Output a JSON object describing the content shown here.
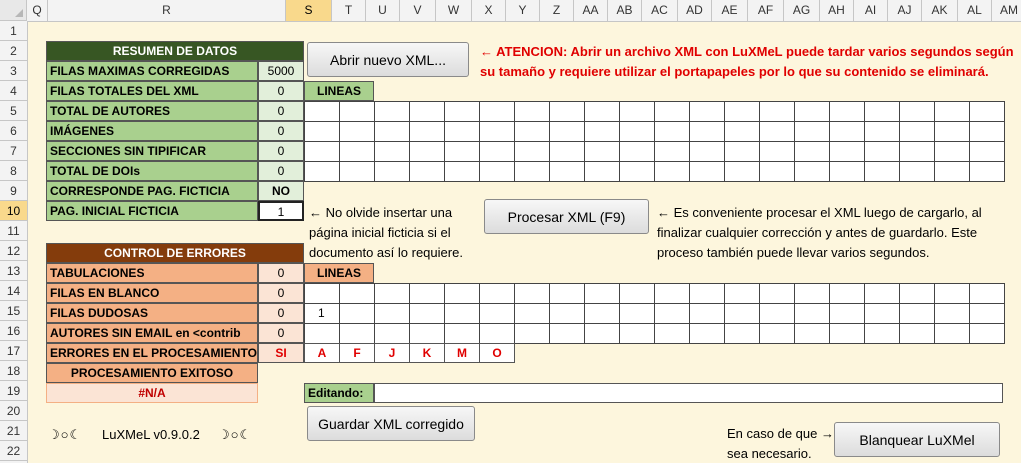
{
  "columns": [
    "Q",
    "R",
    "S",
    "T",
    "U",
    "V",
    "W",
    "X",
    "Y",
    "Z",
    "AA",
    "AB",
    "AC",
    "AD",
    "AE",
    "AF",
    "AG",
    "AH",
    "AI",
    "AJ",
    "AK",
    "AL",
    "AM"
  ],
  "selected_column": "S",
  "rows": [
    "1",
    "2",
    "3",
    "4",
    "5",
    "6",
    "7",
    "8",
    "9",
    "10",
    "11",
    "12",
    "13",
    "14",
    "15",
    "16",
    "17",
    "18",
    "19",
    "20",
    "21",
    "22"
  ],
  "selected_row": "10",
  "resumen": {
    "title": "RESUMEN DE DATOS",
    "items": [
      {
        "label": "FILAS MAXIMAS CORREGIDAS",
        "value": "5000"
      },
      {
        "label": "FILAS TOTALES DEL XML",
        "value": "0"
      },
      {
        "label": "TOTAL DE AUTORES",
        "value": "0"
      },
      {
        "label": "IMÁGENES",
        "value": "0"
      },
      {
        "label": "SECCIONES SIN TIPIFICAR",
        "value": "0"
      },
      {
        "label": "TOTAL DE DOIs",
        "value": "0"
      },
      {
        "label": "CORRESPONDE PAG. FICTICIA",
        "value": "NO"
      },
      {
        "label": "PAG. INICIAL FICTICIA",
        "value": "1"
      }
    ]
  },
  "lineas_label_1": "LINEAS",
  "lineas_label_2": "LINEAS",
  "control": {
    "title": "CONTROL DE ERRORES",
    "items": [
      {
        "label": "TABULACIONES",
        "value": "0"
      },
      {
        "label": "FILAS EN BLANCO",
        "value": "0"
      },
      {
        "label": "FILAS DUDOSAS",
        "value": "0"
      },
      {
        "label": "AUTORES SIN EMAIL en <contrib",
        "value": "0"
      },
      {
        "label": "ERRORES EN EL PROCESAMIENTO",
        "value": "SI"
      }
    ],
    "error_letters": [
      "A",
      "F",
      "J",
      "K",
      "M",
      "O"
    ],
    "exitoso_label": "PROCESAMIENTO EXITOSO",
    "exitoso_value": "#N/A"
  },
  "filas_dudosas_first": "1",
  "buttons": {
    "abrir": "Abrir nuevo XML...",
    "procesar": "Procesar XML (F9)",
    "guardar": "Guardar XML corregido",
    "blanquear": "Blanquear LuXMel"
  },
  "notes": {
    "atencion_1": "← ATENCION: Abrir un archivo XML con LuXMeL puede tardar varios segundos según",
    "atencion_2": "su tamaño y requiere utilizar el portapapeles por lo que su contenido se eliminará.",
    "pag_1": "← No olvide insertar una",
    "pag_2": "página inicial ficticia si el",
    "pag_3": "documento así lo requiere.",
    "proc_1": "← Es conveniente procesar el XML luego de cargarlo, al",
    "proc_2": "finalizar cualquier corrección y antes de guardarlo. Este",
    "proc_3": "proceso también puede llevar varios segundos.",
    "caso_1": "En caso de que →",
    "caso_2": "sea necesario."
  },
  "editando_label": "Editando:",
  "editando_value": "",
  "version": "LuXMeL v0.9.0.2",
  "moon_left": "☽○☾",
  "moon_right": "☽○☾",
  "colors": {
    "green_header": "#375623",
    "green_label": "#a9d08e",
    "brown_header": "#843c0c",
    "orange_label": "#f4b084",
    "error_red": "#e00000"
  }
}
